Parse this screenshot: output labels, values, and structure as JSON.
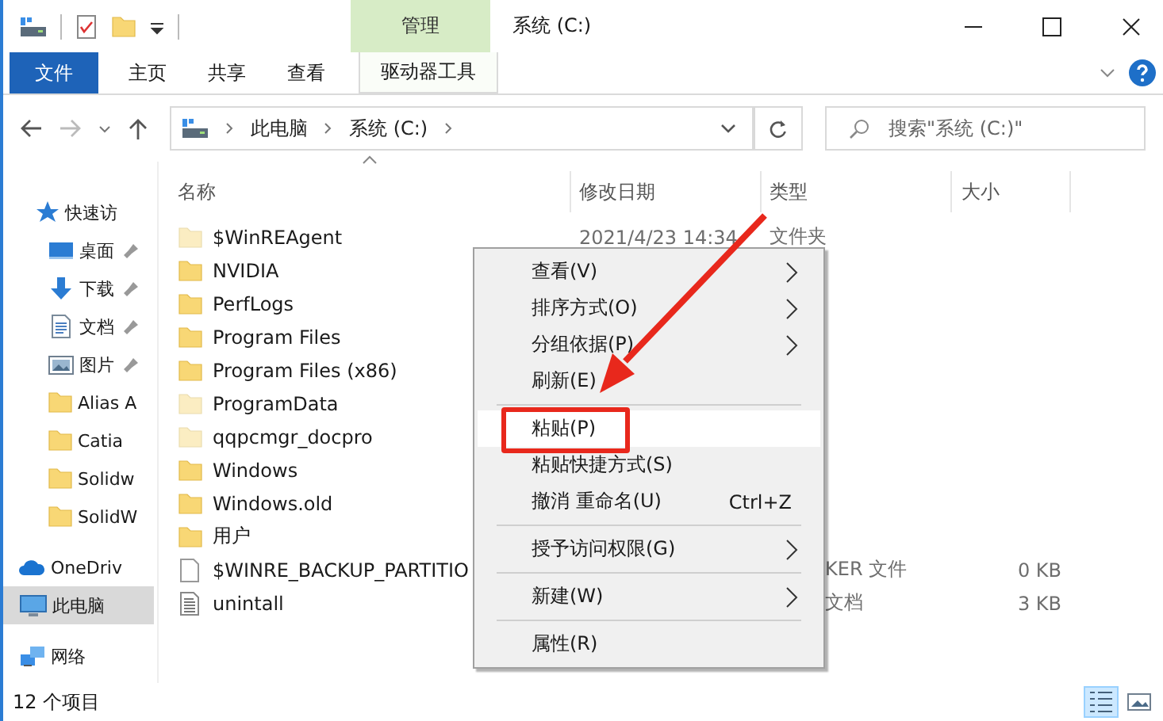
{
  "window": {
    "title": "系统 (C:)",
    "context_group": "管理"
  },
  "ribbon": {
    "tabs": [
      {
        "label": "文件",
        "kind": "file"
      },
      {
        "label": "主页",
        "kind": "normal"
      },
      {
        "label": "共享",
        "kind": "normal"
      },
      {
        "label": "查看",
        "kind": "normal"
      },
      {
        "label": "驱动器工具",
        "kind": "context"
      }
    ]
  },
  "address": {
    "path": [
      "此电脑",
      "系统 (C:)"
    ]
  },
  "search": {
    "placeholder": "搜索\"系统 (C:)\""
  },
  "navigation": {
    "items": [
      {
        "label": "快速访",
        "kind": "star",
        "pinned": false,
        "selected": false
      },
      {
        "label": "桌面",
        "kind": "desktop",
        "pinned": true,
        "selected": false
      },
      {
        "label": "下载",
        "kind": "download",
        "pinned": true,
        "selected": false
      },
      {
        "label": "文档",
        "kind": "document",
        "pinned": true,
        "selected": false
      },
      {
        "label": "图片",
        "kind": "pictures",
        "pinned": true,
        "selected": false
      },
      {
        "label": "Alias A",
        "kind": "folder",
        "pinned": false,
        "selected": false
      },
      {
        "label": "Catia",
        "kind": "folder",
        "pinned": false,
        "selected": false
      },
      {
        "label": "Solidw",
        "kind": "folder",
        "pinned": false,
        "selected": false
      },
      {
        "label": "SolidW",
        "kind": "folder",
        "pinned": false,
        "selected": false
      },
      {
        "label": "OneDriv",
        "kind": "cloud",
        "pinned": false,
        "selected": false
      },
      {
        "label": "此电脑",
        "kind": "computer",
        "pinned": false,
        "selected": true
      },
      {
        "label": "网络",
        "kind": "network",
        "pinned": false,
        "selected": false
      }
    ]
  },
  "file_list": {
    "columns": [
      "名称",
      "修改日期",
      "类型",
      "大小"
    ],
    "rows": [
      {
        "name": "$WinREAgent",
        "kind": "hidden_folder",
        "date": "2021/4/23 14:34",
        "type": "文件夹"
      },
      {
        "name": "NVIDIA",
        "kind": "folder"
      },
      {
        "name": "PerfLogs",
        "kind": "folder"
      },
      {
        "name": "Program Files",
        "kind": "folder"
      },
      {
        "name": "Program Files (x86)",
        "kind": "folder"
      },
      {
        "name": "ProgramData",
        "kind": "hidden_folder"
      },
      {
        "name": "qqpcmgr_docpro",
        "kind": "hidden_folder"
      },
      {
        "name": "Windows",
        "kind": "folder"
      },
      {
        "name": "Windows.old",
        "kind": "folder"
      },
      {
        "name": "用户",
        "kind": "folder"
      },
      {
        "name": "$WINRE_BACKUP_PARTITIO",
        "kind": "blank_file",
        "type": "KER 文件",
        "size": "0 KB"
      },
      {
        "name": "unintall",
        "kind": "text_file",
        "type": "文档",
        "size": "3 KB"
      }
    ]
  },
  "context_menu": {
    "items": [
      {
        "kind": "item",
        "label": "查看(V)",
        "submenu": true,
        "highlighted": false
      },
      {
        "kind": "item",
        "label": "排序方式(O)",
        "submenu": true,
        "highlighted": false
      },
      {
        "kind": "item",
        "label": "分组依据(P)",
        "submenu": true,
        "highlighted": false
      },
      {
        "kind": "item",
        "label": "刷新(E)",
        "submenu": false,
        "highlighted": false
      },
      {
        "kind": "separator"
      },
      {
        "kind": "item",
        "label": "粘贴(P)",
        "submenu": false,
        "highlighted": true
      },
      {
        "kind": "item",
        "label": "粘贴快捷方式(S)",
        "submenu": false,
        "highlighted": false
      },
      {
        "kind": "item",
        "label": "撤消 重命名(U)",
        "shortcut": "Ctrl+Z",
        "submenu": false,
        "highlighted": false
      },
      {
        "kind": "separator"
      },
      {
        "kind": "item",
        "label": "授予访问权限(G)",
        "submenu": true,
        "highlighted": false
      },
      {
        "kind": "separator"
      },
      {
        "kind": "item",
        "label": "新建(W)",
        "submenu": true,
        "highlighted": false
      },
      {
        "kind": "separator"
      },
      {
        "kind": "item",
        "label": "属性(R)",
        "submenu": false,
        "highlighted": false
      }
    ]
  },
  "status_bar": {
    "count": "12 个项目",
    "views": [
      {
        "kind": "details",
        "selected": true
      },
      {
        "kind": "thumbnails",
        "selected": false
      }
    ]
  }
}
